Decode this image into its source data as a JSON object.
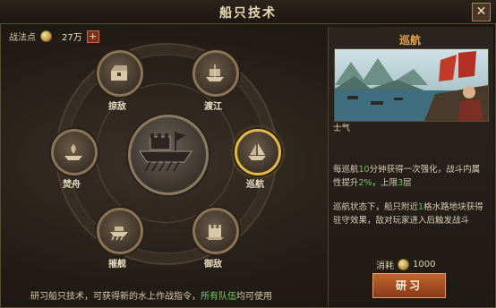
{
  "window": {
    "title": "船只技术",
    "close_glyph": "✕"
  },
  "points": {
    "label": "战法点",
    "amount": "27万",
    "add_glyph": "+"
  },
  "center": {
    "icon": "warship-icon"
  },
  "nodes": [
    {
      "label": "掠敌",
      "icon": "chest-icon"
    },
    {
      "label": "渡江",
      "icon": "ship-icon"
    },
    {
      "label": "焚舟",
      "icon": "fire-ship-icon"
    },
    {
      "label": "巡航",
      "icon": "sail-ship-icon",
      "selected": true
    },
    {
      "label": "摧舰",
      "icon": "galley-icon"
    },
    {
      "label": "御敌",
      "icon": "castle-icon"
    }
  ],
  "hint": {
    "prefix": "研习船只技术，可获得新的水上作战指令，",
    "highlight": "所有队伍",
    "suffix": "均可使用"
  },
  "detail": {
    "title": "巡航",
    "p0": "士气",
    "p1a": "每巡航",
    "p1b": "10",
    "p1c": "分钟获得一次强化，战斗内属性提升",
    "p1d": "2%",
    "p1e": "，上限",
    "p1f": "3",
    "p1g": "层",
    "p2a": "巡航状态下，船只附近",
    "p2b": "1",
    "p2c": "格水路地块获得驻守效果，敌对玩家进入后触发战斗",
    "cost_label": "消耗",
    "cost_value": "1000",
    "study_label": "研习"
  },
  "colors": {
    "accent": "#e9a64a",
    "highlight": "#5fd04b",
    "selected_ring": "#e3b84a"
  }
}
